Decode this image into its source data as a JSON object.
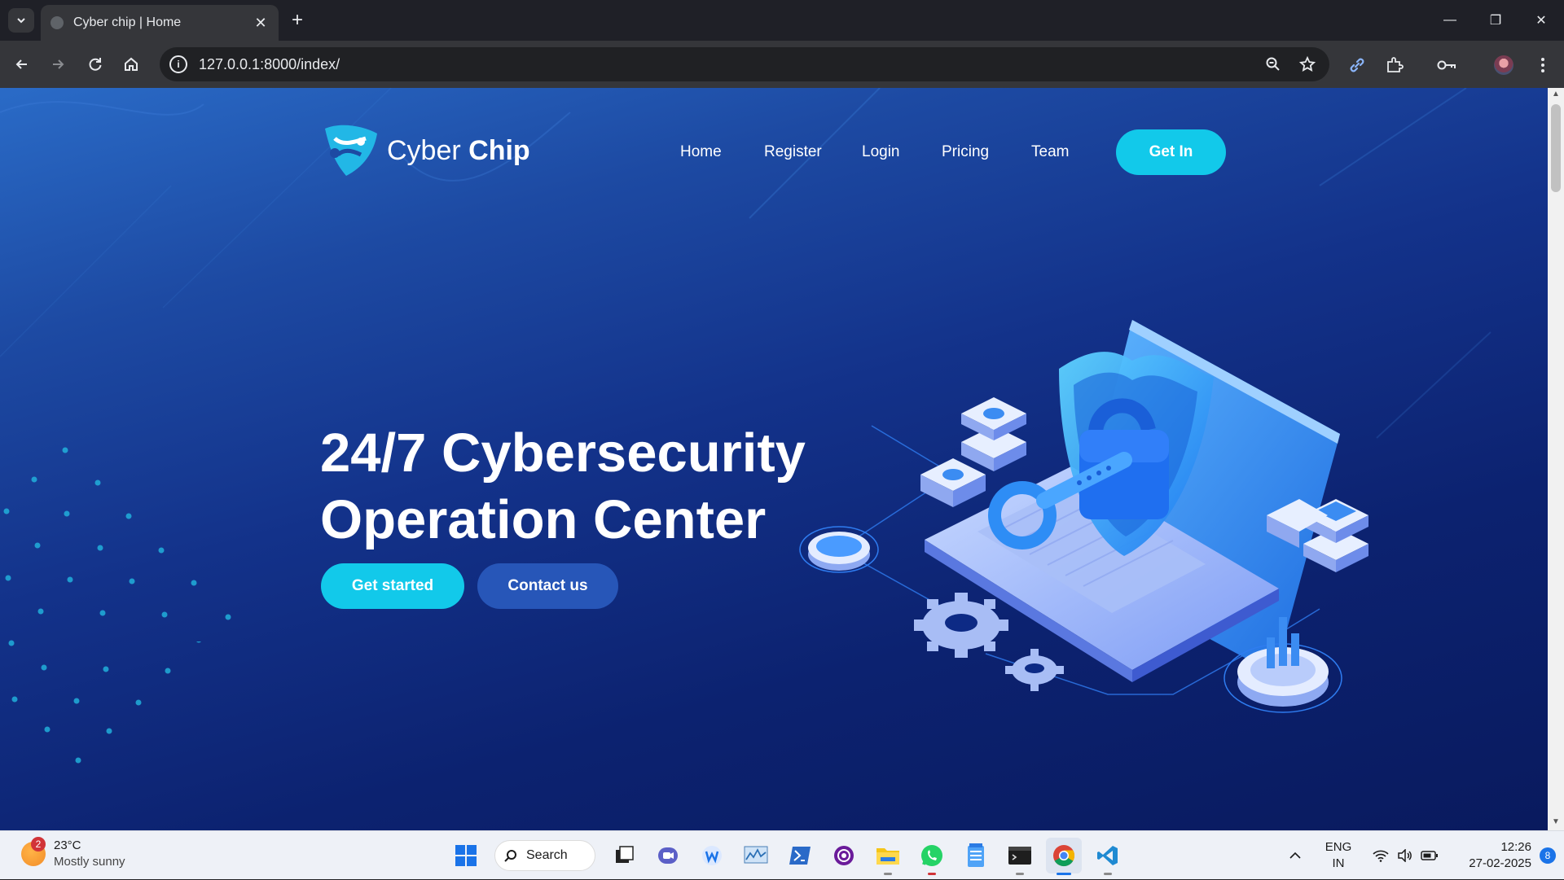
{
  "browser": {
    "tab_title": "Cyber chip | Home",
    "url": "127.0.0.1:8000/index/"
  },
  "site": {
    "logo_word1": "Cyber",
    "logo_word2": "Chip",
    "nav": [
      "Home",
      "Register",
      "Login",
      "Pricing",
      "Team"
    ],
    "cta": "Get In",
    "hero_line1": "24/7 Cybersecurity",
    "hero_line2": "Operation Center",
    "btn_primary": "Get started",
    "btn_secondary": "Contact us"
  },
  "taskbar": {
    "weather_temp": "23°C",
    "weather_desc": "Mostly sunny",
    "weather_badge": "2",
    "search_label": "Search",
    "lang_top": "ENG",
    "lang_bottom": "IN",
    "time": "12:26",
    "date": "27-02-2025",
    "notif_count": "8"
  },
  "colors": {
    "accent": "#12c9ea",
    "secondary_button": "#2756b8",
    "page_bg_top": "#2a6bc7",
    "page_bg_bottom": "#091a5e"
  }
}
